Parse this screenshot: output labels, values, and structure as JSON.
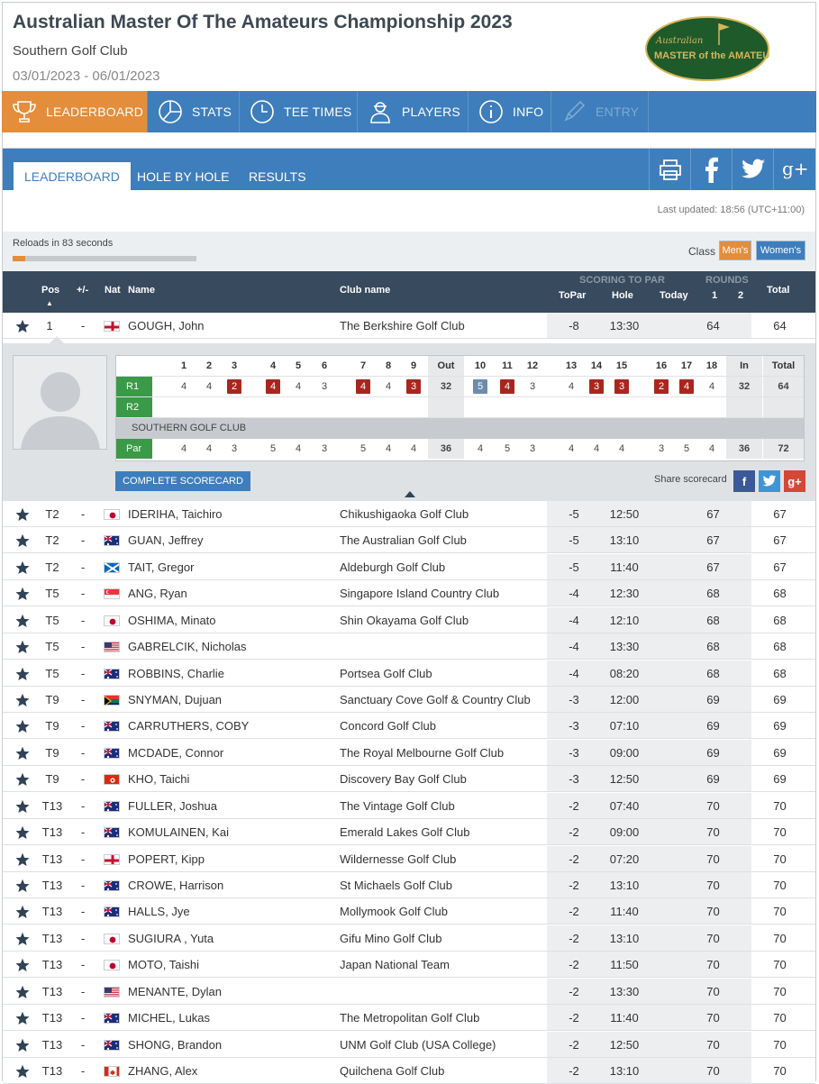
{
  "header": {
    "title": "Australian Master Of The Amateurs Championship 2023",
    "venue": "Southern Golf Club",
    "dates": "03/01/2023 - 06/01/2023",
    "logo_line1": "Australian",
    "logo_line2": "MASTER of the AMATEURS"
  },
  "main_nav": [
    {
      "label": "LEADERBOARD",
      "icon": "trophy-icon",
      "state": "active"
    },
    {
      "label": "STATS",
      "icon": "pie-chart-icon",
      "state": "normal"
    },
    {
      "label": "TEE TIMES",
      "icon": "clock-icon",
      "state": "normal"
    },
    {
      "label": "PLAYERS",
      "icon": "player-icon",
      "state": "normal"
    },
    {
      "label": "INFO",
      "icon": "info-icon",
      "state": "normal"
    },
    {
      "label": "ENTRY",
      "icon": "pen-icon",
      "state": "disabled"
    }
  ],
  "sub_nav": {
    "tabs": [
      "LEADERBOARD",
      "HOLE BY HOLE",
      "RESULTS"
    ],
    "active": "LEADERBOARD",
    "social": [
      "print-icon",
      "facebook-icon",
      "twitter-icon",
      "google-plus-icon"
    ]
  },
  "status": {
    "last_updated": "Last updated: 18:56 (UTC+11:00)",
    "reloads": "Reloads in 83 seconds",
    "reload_progress": 0.07
  },
  "class_filter": {
    "label": "Class",
    "options": [
      "Men's",
      "Women's"
    ],
    "selected": "Men's"
  },
  "table_header": {
    "pos": "Pos",
    "change": "+/-",
    "nat": "Nat",
    "name": "Name",
    "club": "Club name",
    "scoring_group": "SCORING TO PAR",
    "topar": "ToPar",
    "hole": "Hole",
    "today": "Today",
    "rounds_group": "ROUNDS",
    "r1": "1",
    "r2": "2",
    "total": "Total"
  },
  "expanded_player": {
    "pos": "1",
    "change": "-",
    "nat": "ENG",
    "name": "GOUGH, John",
    "club": "The Berkshire Golf Club",
    "topar": "-8",
    "hole": "13:30",
    "today": "",
    "r1": "64",
    "r2": "",
    "total": "64"
  },
  "scorecard": {
    "holes_front": [
      "1",
      "2",
      "3",
      "4",
      "5",
      "6",
      "7",
      "8",
      "9"
    ],
    "out_label": "Out",
    "holes_back": [
      "10",
      "11",
      "12",
      "13",
      "14",
      "15",
      "16",
      "17",
      "18"
    ],
    "in_label": "In",
    "total_label": "Total",
    "rounds": [
      {
        "label": "R1",
        "front": [
          "4",
          "4",
          "2",
          "4",
          "4",
          "3",
          "4",
          "4",
          "3"
        ],
        "front_status": [
          "par",
          "par",
          "bogey",
          "bogey",
          "par",
          "par",
          "bogey",
          "par",
          "bogey"
        ],
        "out": "32",
        "back": [
          "5",
          "4",
          "3",
          "4",
          "3",
          "3",
          "2",
          "4",
          "4"
        ],
        "back_status": [
          "birdie",
          "bogey",
          "par",
          "par",
          "bogey",
          "bogey",
          "bogey",
          "bogey",
          "par"
        ],
        "in": "32",
        "total": "64"
      },
      {
        "label": "R2",
        "front": [],
        "out": "",
        "back": [],
        "in": "",
        "total": ""
      }
    ],
    "club_name": "SOUTHERN GOLF CLUB",
    "par": {
      "label": "Par",
      "front": [
        "4",
        "4",
        "3",
        "5",
        "4",
        "3",
        "5",
        "4",
        "4"
      ],
      "out": "36",
      "back": [
        "4",
        "5",
        "3",
        "4",
        "4",
        "4",
        "3",
        "5",
        "4"
      ],
      "in": "36",
      "total": "72"
    },
    "complete_label": "COMPLETE SCORECARD",
    "share_label": "Share scorecard",
    "share_icons": [
      "facebook-icon",
      "twitter-icon",
      "google-plus-icon"
    ]
  },
  "players": [
    {
      "pos": "T2",
      "change": "-",
      "nat": "JPN",
      "name": "IDERIHA, Taichiro",
      "club": "Chikushigaoka Golf Club",
      "topar": "-5",
      "hole": "12:50",
      "today": "",
      "r1": "67",
      "r2": "",
      "total": "67"
    },
    {
      "pos": "T2",
      "change": "-",
      "nat": "AUS",
      "name": "GUAN, Jeffrey",
      "club": "The Australian Golf Club",
      "topar": "-5",
      "hole": "13:10",
      "today": "",
      "r1": "67",
      "r2": "",
      "total": "67"
    },
    {
      "pos": "T2",
      "change": "-",
      "nat": "SCO",
      "name": "TAIT, Gregor",
      "club": "Aldeburgh Golf Club",
      "topar": "-5",
      "hole": "11:40",
      "today": "",
      "r1": "67",
      "r2": "",
      "total": "67"
    },
    {
      "pos": "T5",
      "change": "-",
      "nat": "SGP",
      "name": "ANG, Ryan",
      "club": "Singapore Island Country Club",
      "topar": "-4",
      "hole": "12:30",
      "today": "",
      "r1": "68",
      "r2": "",
      "total": "68"
    },
    {
      "pos": "T5",
      "change": "-",
      "nat": "JPN",
      "name": "OSHIMA, Minato",
      "club": "Shin Okayama Golf Club",
      "topar": "-4",
      "hole": "12:10",
      "today": "",
      "r1": "68",
      "r2": "",
      "total": "68"
    },
    {
      "pos": "T5",
      "change": "-",
      "nat": "USA",
      "name": "GABRELCIK, Nicholas",
      "club": "",
      "topar": "-4",
      "hole": "13:30",
      "today": "",
      "r1": "68",
      "r2": "",
      "total": "68"
    },
    {
      "pos": "T5",
      "change": "-",
      "nat": "AUS",
      "name": "ROBBINS, Charlie",
      "club": "Portsea Golf Club",
      "topar": "-4",
      "hole": "08:20",
      "today": "",
      "r1": "68",
      "r2": "",
      "total": "68"
    },
    {
      "pos": "T9",
      "change": "-",
      "nat": "RSA",
      "name": "SNYMAN, Dujuan",
      "club": "Sanctuary Cove Golf & Country Club",
      "topar": "-3",
      "hole": "12:00",
      "today": "",
      "r1": "69",
      "r2": "",
      "total": "69"
    },
    {
      "pos": "T9",
      "change": "-",
      "nat": "AUS",
      "name": "CARRUTHERS, COBY",
      "club": "Concord Golf Club",
      "topar": "-3",
      "hole": "07:10",
      "today": "",
      "r1": "69",
      "r2": "",
      "total": "69"
    },
    {
      "pos": "T9",
      "change": "-",
      "nat": "AUS",
      "name": "MCDADE, Connor",
      "club": "The Royal Melbourne Golf Club",
      "topar": "-3",
      "hole": "09:00",
      "today": "",
      "r1": "69",
      "r2": "",
      "total": "69"
    },
    {
      "pos": "T9",
      "change": "-",
      "nat": "HKG",
      "name": "KHO, Taichi",
      "club": "Discovery Bay Golf Club",
      "topar": "-3",
      "hole": "12:50",
      "today": "",
      "r1": "69",
      "r2": "",
      "total": "69"
    },
    {
      "pos": "T13",
      "change": "-",
      "nat": "AUS",
      "name": "FULLER, Joshua",
      "club": "The Vintage Golf Club",
      "topar": "-2",
      "hole": "07:40",
      "today": "",
      "r1": "70",
      "r2": "",
      "total": "70"
    },
    {
      "pos": "T13",
      "change": "-",
      "nat": "AUS",
      "name": "KOMULAINEN, Kai",
      "club": "Emerald Lakes Golf Club",
      "topar": "-2",
      "hole": "09:00",
      "today": "",
      "r1": "70",
      "r2": "",
      "total": "70"
    },
    {
      "pos": "T13",
      "change": "-",
      "nat": "ENG",
      "name": "POPERT, Kipp",
      "club": "Wildernesse Golf Club",
      "topar": "-2",
      "hole": "07:20",
      "today": "",
      "r1": "70",
      "r2": "",
      "total": "70"
    },
    {
      "pos": "T13",
      "change": "-",
      "nat": "AUS",
      "name": "CROWE, Harrison",
      "club": "St Michaels Golf Club",
      "topar": "-2",
      "hole": "13:10",
      "today": "",
      "r1": "70",
      "r2": "",
      "total": "70"
    },
    {
      "pos": "T13",
      "change": "-",
      "nat": "AUS",
      "name": "HALLS, Jye",
      "club": "Mollymook Golf Club",
      "topar": "-2",
      "hole": "11:40",
      "today": "",
      "r1": "70",
      "r2": "",
      "total": "70"
    },
    {
      "pos": "T13",
      "change": "-",
      "nat": "JPN",
      "name": "SUGIURA , Yuta",
      "club": "Gifu Mino Golf Club",
      "topar": "-2",
      "hole": "13:10",
      "today": "",
      "r1": "70",
      "r2": "",
      "total": "70"
    },
    {
      "pos": "T13",
      "change": "-",
      "nat": "JPN",
      "name": "MOTO, Taishi",
      "club": "Japan National Team",
      "topar": "-2",
      "hole": "11:50",
      "today": "",
      "r1": "70",
      "r2": "",
      "total": "70"
    },
    {
      "pos": "T13",
      "change": "-",
      "nat": "USA",
      "name": "MENANTE, Dylan",
      "club": "",
      "topar": "-2",
      "hole": "13:30",
      "today": "",
      "r1": "70",
      "r2": "",
      "total": "70"
    },
    {
      "pos": "T13",
      "change": "-",
      "nat": "AUS",
      "name": "MICHEL, Lukas",
      "club": "The Metropolitan Golf Club",
      "topar": "-2",
      "hole": "11:40",
      "today": "",
      "r1": "70",
      "r2": "",
      "total": "70"
    },
    {
      "pos": "T13",
      "change": "-",
      "nat": "AUS",
      "name": "SHONG, Brandon",
      "club": "UNM Golf Club (USA College)",
      "topar": "-2",
      "hole": "12:50",
      "today": "",
      "r1": "70",
      "r2": "",
      "total": "70"
    },
    {
      "pos": "T13",
      "change": "-",
      "nat": "CAN",
      "name": "ZHANG, Alex",
      "club": "Quilchena Golf Club",
      "topar": "-2",
      "hole": "13:10",
      "today": "",
      "r1": "70",
      "r2": "",
      "total": "70"
    }
  ],
  "colors": {
    "nav_blue": "#3e7ebd",
    "active_orange": "#e48d3b",
    "header_dark": "#374a5e",
    "bogey_red": "#a9261f",
    "birdie_blue": "#6d8caa",
    "par_green": "#3a9a48",
    "logo_green": "#1f5a2b",
    "logo_gold": "#d6b55a"
  }
}
